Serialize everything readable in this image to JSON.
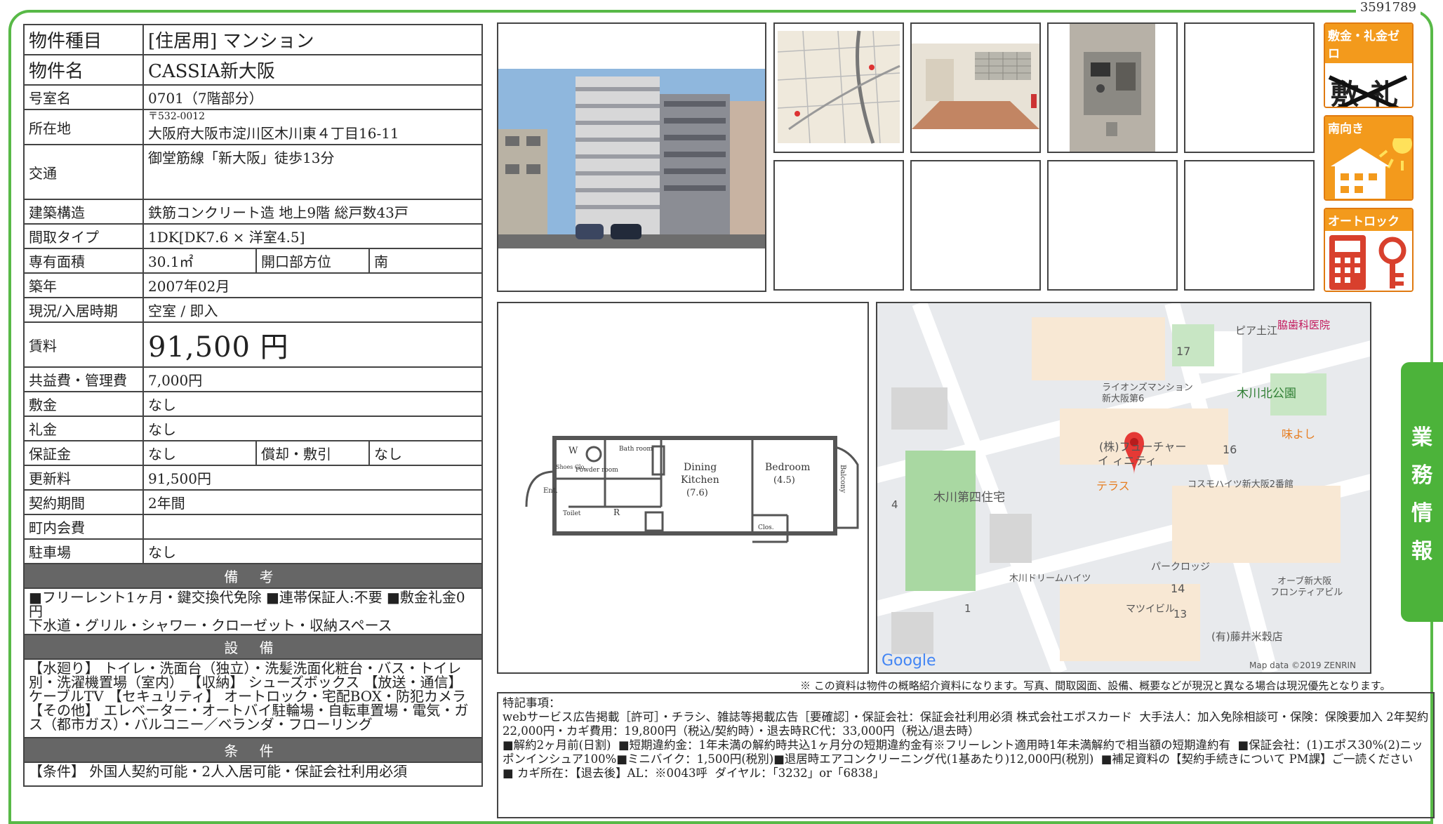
{
  "doc_id": "3591789",
  "property": {
    "type_label": "物件種目",
    "type_value": "[住居用]  マンション",
    "name_label": "物件名",
    "name_value": "CASSIA新大阪",
    "room_label": "号室名",
    "room_value": "0701（7階部分）",
    "address_label": "所在地",
    "postal": "〒532-0012",
    "address_value": "大阪府大阪市淀川区木川東４丁目16-11",
    "transport_label": "交通",
    "transport_value": "御堂筋線「新大阪」徒歩13分",
    "structure_label": "建築構造",
    "structure_value": "鉄筋コンクリート造  地上9階  総戸数43戸",
    "layout_label": "間取タイプ",
    "layout_value": "1DK[DK7.6 × 洋室4.5]",
    "area_label": "専有面積",
    "area_value": "30.1㎡",
    "facing_label": "開口部方位",
    "facing_value": "南",
    "built_label": "築年",
    "built_value": "2007年02月",
    "status_label": "現況/入居時期",
    "status_value": "空室  /  即入",
    "rent_label": "賃料",
    "rent_value": "91,500 円",
    "fee_label": "共益費・管理費",
    "fee_value": "7,000円",
    "deposit_label": "敷金",
    "deposit_value": "なし",
    "keymoney_label": "礼金",
    "keymoney_value": "なし",
    "guarantee_label": "保証金",
    "guarantee_value": "なし",
    "amort_label": "償却・敷引",
    "amort_value": "なし",
    "renewal_label": "更新料",
    "renewal_value": "91,500円",
    "term_label": "契約期間",
    "term_value": "2年間",
    "community_label": "町内会費",
    "community_value": "",
    "parking_label": "駐車場",
    "parking_value": "なし"
  },
  "sections": {
    "biko_title": "備 考",
    "biko_text": "■フリーレント1ヶ月・鍵交換代免除  ■連帯保証人:不要  ■敷金礼金0円\n下水道・グリル・シャワー・クローゼット・収納スペース",
    "setsubi_title": "設 備",
    "setsubi_text": "【水廻り】 トイレ・洗面台（独立）・洗髪洗面化粧台・バス・トイレ別・洗濯機置場（室内）  【収納】 シューズボックス  【放送・通信】 ケーブルTV  【セキュリティ】 オートロック・宅配BOX・防犯カメラ  【その他】 エレベーター・オートバイ駐輪場・自転車置場・電気・ガス（都市ガス）・バルコニー／ベランダ・フローリング",
    "joken_title": "条 件",
    "joken_text": "【条件】 外国人契約可能・2人入居可能・保証会社利用必須"
  },
  "badges": [
    {
      "title": "敷金・礼金ゼロ",
      "icon": "no-deposit-icon"
    },
    {
      "title": "南向き",
      "icon": "south-facing-icon"
    },
    {
      "title": "オートロック",
      "icon": "autolock-icon"
    }
  ],
  "side_tab": [
    "業",
    "務",
    "情",
    "報"
  ],
  "floorplan": {
    "dining": "Dining",
    "kitchen": "Kitchen",
    "dk_size": "(7.6)",
    "bedroom": "Bedroom",
    "bed_size": "(4.5)",
    "balcony": "Balcony",
    "entrance": "Ent.",
    "shoes": "Shoes Clo.",
    "powder": "Powder room",
    "bath": "Bath room",
    "toilet": "Toilet",
    "closet": "Clos.",
    "w": "W",
    "r": "R"
  },
  "map": {
    "labels": [
      "ピア土江",
      "脇歯科医院",
      "17",
      "ライオンズマンション",
      "新大阪第6",
      "木川北公園",
      "(株)フューチャー",
      "イ ィニティ",
      "味よし",
      "16",
      "テラス",
      "コスモハイツ新大阪2番館",
      "4",
      "木川第四住宅",
      "パークロッジ",
      "14",
      "木川ドリームハイツ",
      "オーブ新大阪",
      "フロンティアビル",
      "1",
      "マツイビル",
      "13",
      "(有)藤井米穀店"
    ],
    "google": "Google",
    "copyright": "Map data ©2019 ZENRIN"
  },
  "disclaimer": "※ この資料は物件の概略紹介資料になります。写真、間取図面、設備、概要などが現況と異なる場合は現況優先となります。",
  "remarks": {
    "title": "特記事項：",
    "lines": [
      "webサービス広告掲載［許可］・チラシ、雑誌等掲載広告［要確認］・保証会社：保証会社利用必須 株式会社エポスカード  大手法人：加入免除相談可・保険：保険要加入 2年契約 22,000円・カギ費用：19,800円（税込/契約時）・退去時RC代：33,000円（税込/退去時）",
      "■解約2ヶ月前(日割)  ■短期違約金：1年未満の解約時共込1ヶ月分の短期違約金有※フリーレント適用時1年未満解約で相当額の短期違約有  ■保証会社：(1)エポス30%(2)ニッポンインシュア100%■ミニバイク：1,500円(税別)■退居時エアコンクリーニング代(1基あたり)12,000円(税別)  ■補足資料の【契約手続きについて PM課】ご一読ください",
      "■ カギ所在：【退去後】AL：※0043呼  ダイヤル：「3232」or「6838」"
    ]
  }
}
